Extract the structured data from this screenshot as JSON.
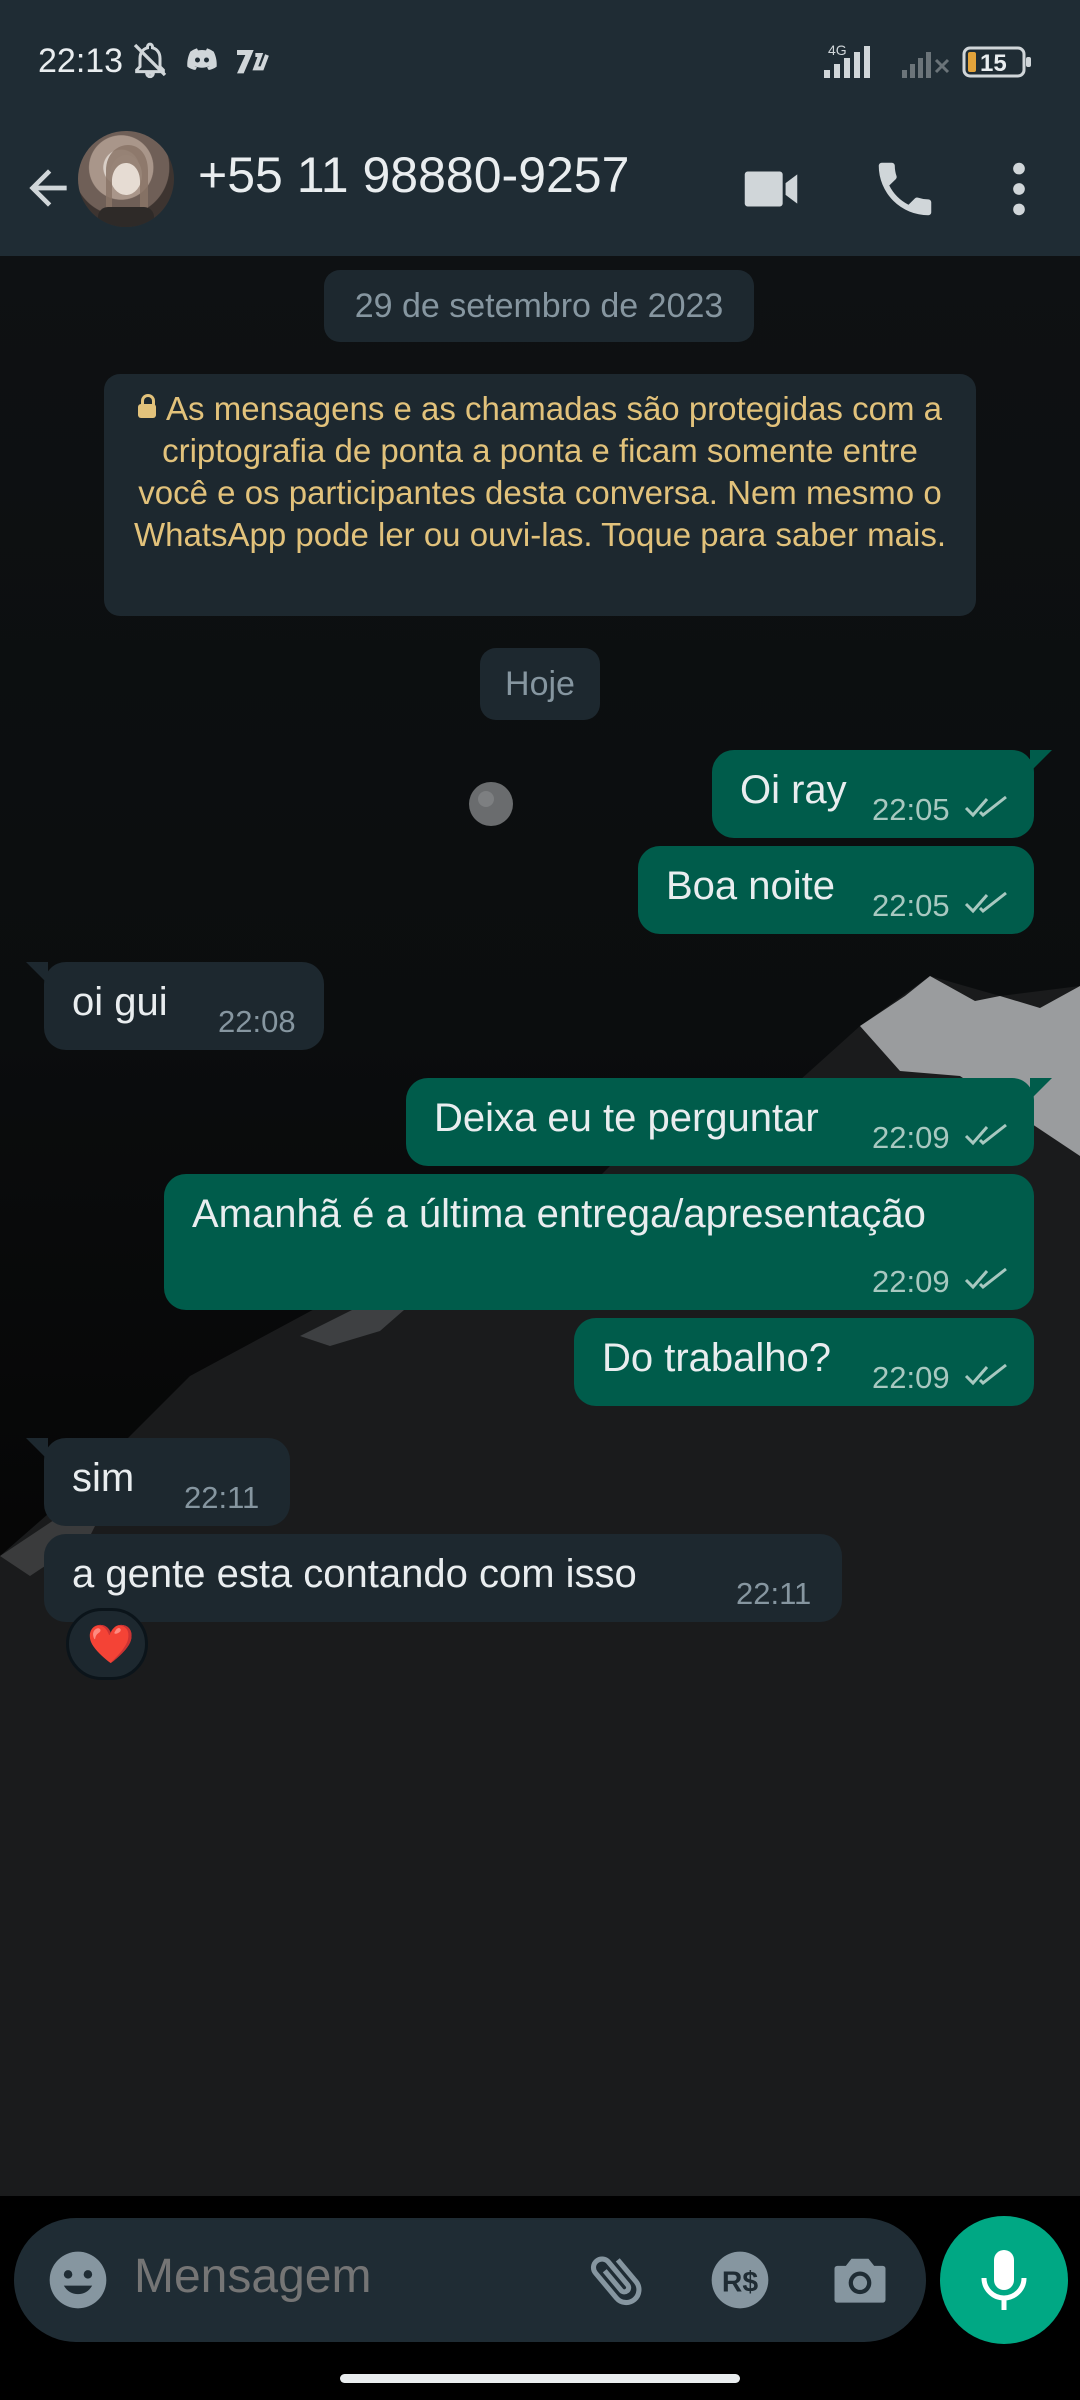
{
  "status_bar": {
    "time": "22:13",
    "network": "4G",
    "battery": "15"
  },
  "header": {
    "contact_name": "+55 11 98880-9257"
  },
  "chat": {
    "date_chip": "29 de setembro de 2023",
    "encryption_notice": "As mensagens e as chamadas são protegidas com a criptografia de ponta a ponta e ficam somente entre você e os participantes desta conversa. Nem mesmo o WhatsApp pode ler ou ouvi-las. Toque para saber mais.",
    "today_chip": "Hoje",
    "messages": [
      {
        "direction": "out",
        "text": "Oi ray",
        "time": "22:05",
        "status": "read"
      },
      {
        "direction": "out",
        "text": "Boa noite",
        "time": "22:05",
        "status": "read"
      },
      {
        "direction": "in",
        "text": "oi gui",
        "time": "22:08"
      },
      {
        "direction": "out",
        "text": "Deixa eu te perguntar",
        "time": "22:09",
        "status": "read"
      },
      {
        "direction": "out",
        "text": "Amanhã é a última entrega/apresentação",
        "time": "22:09",
        "status": "read"
      },
      {
        "direction": "out",
        "text": "Do trabalho?",
        "time": "22:09",
        "status": "read"
      },
      {
        "direction": "in",
        "text": "sim",
        "time": "22:11"
      },
      {
        "direction": "in",
        "text": "a gente esta contando com isso",
        "time": "22:11",
        "reaction": "❤️"
      }
    ]
  },
  "composer": {
    "placeholder": "Mensagem"
  },
  "colors": {
    "outgoing": "#005c4b",
    "incoming": "#1d282f",
    "accent": "#00a884",
    "header": "#1f2c34",
    "notice_text": "#e2c27b"
  },
  "icons": [
    "back-arrow-icon",
    "video-call-icon",
    "voice-call-icon",
    "more-vert-icon",
    "emoji-icon",
    "attach-icon",
    "payment-icon",
    "camera-icon",
    "mic-icon"
  ]
}
